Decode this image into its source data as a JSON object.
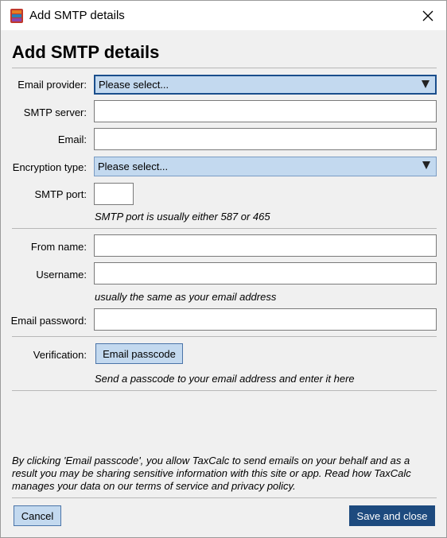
{
  "window": {
    "title": "Add SMTP details"
  },
  "heading": "Add SMTP details",
  "fields": {
    "email_provider": {
      "label": "Email provider:",
      "value": "Please select..."
    },
    "smtp_server": {
      "label": "SMTP server:",
      "value": ""
    },
    "email": {
      "label": "Email:",
      "value": ""
    },
    "encryption_type": {
      "label": "Encryption type:",
      "value": "Please select..."
    },
    "smtp_port": {
      "label": "SMTP port:",
      "value": "",
      "hint": "SMTP port is usually either 587 or 465"
    },
    "from_name": {
      "label": "From name:",
      "value": ""
    },
    "username": {
      "label": "Username:",
      "value": "",
      "hint": "usually the same as your email address"
    },
    "email_password": {
      "label": "Email password:",
      "value": ""
    },
    "verification": {
      "label": "Verification:",
      "button": "Email passcode",
      "hint": "Send a passcode to your email address and enter it here"
    }
  },
  "disclaimer": "By clicking 'Email passcode', you allow TaxCalc to send emails on your behalf and as a result you may be sharing sensitive information with this site or app. Read how TaxCalc manages your data on our terms of service and privacy policy.",
  "footer": {
    "cancel": "Cancel",
    "save": "Save and close"
  },
  "colors": {
    "accent": "#1d4a7e",
    "select_bg": "#c3d9ef"
  },
  "icons": {
    "app": "app-icon",
    "close": "close-icon",
    "dropdown": "chevron-down-icon"
  }
}
